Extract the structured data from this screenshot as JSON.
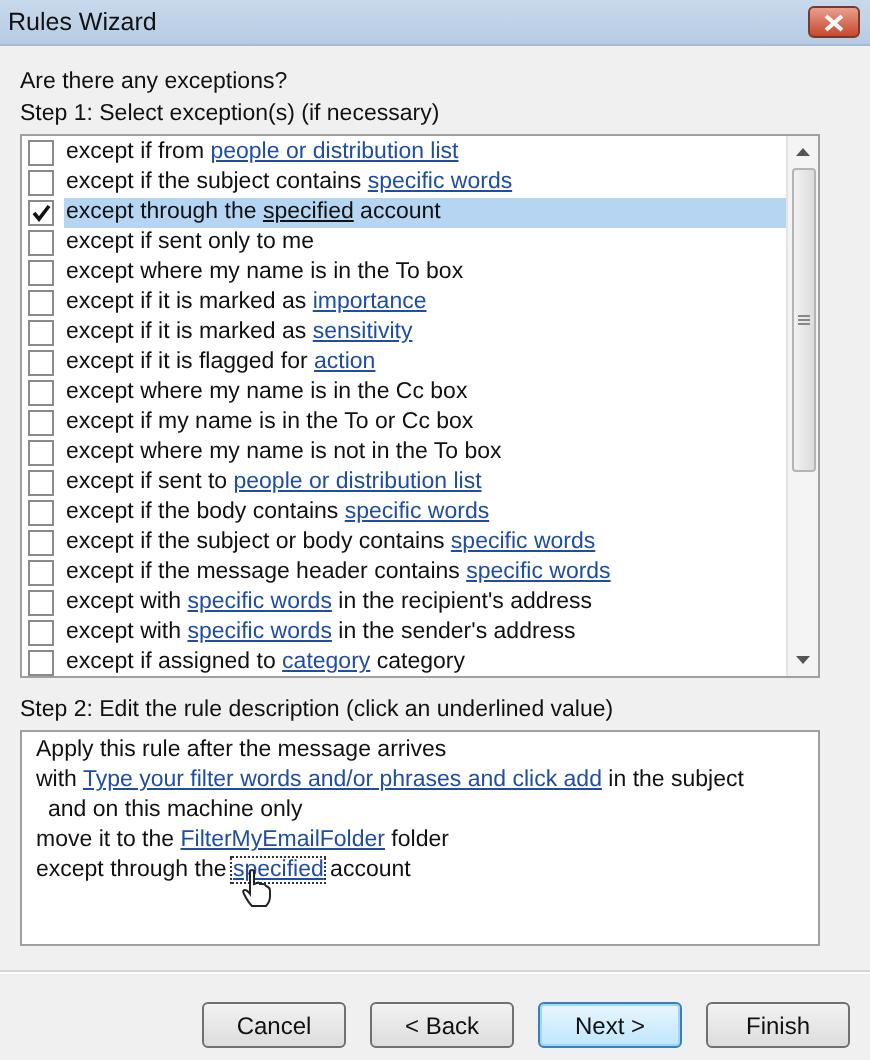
{
  "window": {
    "title": "Rules Wizard"
  },
  "question": "Are there any exceptions?",
  "step1_label": "Step 1: Select exception(s) (if necessary)",
  "exceptions": [
    {
      "checked": false,
      "selected": false,
      "parts": [
        {
          "text": "except if from ",
          "link": false
        },
        {
          "text": "people or distribution list",
          "link": true
        }
      ]
    },
    {
      "checked": false,
      "selected": false,
      "parts": [
        {
          "text": "except if the subject contains ",
          "link": false
        },
        {
          "text": "specific words",
          "link": true
        }
      ]
    },
    {
      "checked": true,
      "selected": true,
      "parts": [
        {
          "text": "except through the ",
          "link": false
        },
        {
          "text": "specified",
          "link": true
        },
        {
          "text": " account",
          "link": false
        }
      ]
    },
    {
      "checked": false,
      "selected": false,
      "parts": [
        {
          "text": "except if sent only to me",
          "link": false
        }
      ]
    },
    {
      "checked": false,
      "selected": false,
      "parts": [
        {
          "text": "except where my name is in the To box",
          "link": false
        }
      ]
    },
    {
      "checked": false,
      "selected": false,
      "parts": [
        {
          "text": "except if it is marked as ",
          "link": false
        },
        {
          "text": "importance",
          "link": true
        }
      ]
    },
    {
      "checked": false,
      "selected": false,
      "parts": [
        {
          "text": "except if it is marked as ",
          "link": false
        },
        {
          "text": "sensitivity",
          "link": true
        }
      ]
    },
    {
      "checked": false,
      "selected": false,
      "parts": [
        {
          "text": "except if it is flagged for ",
          "link": false
        },
        {
          "text": "action",
          "link": true
        }
      ]
    },
    {
      "checked": false,
      "selected": false,
      "parts": [
        {
          "text": "except where my name is in the Cc box",
          "link": false
        }
      ]
    },
    {
      "checked": false,
      "selected": false,
      "parts": [
        {
          "text": "except if my name is in the To or Cc box",
          "link": false
        }
      ]
    },
    {
      "checked": false,
      "selected": false,
      "parts": [
        {
          "text": "except where my name is not in the To box",
          "link": false
        }
      ]
    },
    {
      "checked": false,
      "selected": false,
      "parts": [
        {
          "text": "except if sent to ",
          "link": false
        },
        {
          "text": "people or distribution list",
          "link": true
        }
      ]
    },
    {
      "checked": false,
      "selected": false,
      "parts": [
        {
          "text": "except if the body contains ",
          "link": false
        },
        {
          "text": "specific words",
          "link": true
        }
      ]
    },
    {
      "checked": false,
      "selected": false,
      "parts": [
        {
          "text": "except if the subject or body contains ",
          "link": false
        },
        {
          "text": "specific words",
          "link": true
        }
      ]
    },
    {
      "checked": false,
      "selected": false,
      "parts": [
        {
          "text": "except if the message header contains ",
          "link": false
        },
        {
          "text": "specific words",
          "link": true
        }
      ]
    },
    {
      "checked": false,
      "selected": false,
      "parts": [
        {
          "text": "except with ",
          "link": false
        },
        {
          "text": "specific words",
          "link": true
        },
        {
          "text": " in the recipient's address",
          "link": false
        }
      ]
    },
    {
      "checked": false,
      "selected": false,
      "parts": [
        {
          "text": "except with ",
          "link": false
        },
        {
          "text": "specific words",
          "link": true
        },
        {
          "text": " in the sender's address",
          "link": false
        }
      ]
    },
    {
      "checked": false,
      "selected": false,
      "parts": [
        {
          "text": "except if assigned to ",
          "link": false
        },
        {
          "text": "category",
          "link": true
        },
        {
          "text": " category",
          "link": false
        }
      ]
    }
  ],
  "step2_label": "Step 2: Edit the rule description (click an underlined value)",
  "description": [
    {
      "indent": false,
      "parts": [
        {
          "text": "Apply this rule after the message arrives",
          "link": false
        }
      ]
    },
    {
      "indent": false,
      "parts": [
        {
          "text": "with ",
          "link": false
        },
        {
          "text": "Type your filter words and/or phrases and click add",
          "link": true
        },
        {
          "text": " in the subject",
          "link": false
        }
      ]
    },
    {
      "indent": true,
      "parts": [
        {
          "text": "and on this machine only",
          "link": false
        }
      ]
    },
    {
      "indent": false,
      "parts": [
        {
          "text": "move it to the ",
          "link": false
        },
        {
          "text": "FilterMyEmailFolder",
          "link": true
        },
        {
          "text": " folder",
          "link": false
        }
      ]
    },
    {
      "indent": false,
      "parts": [
        {
          "text": "except through the ",
          "link": false
        },
        {
          "text": "specified",
          "link": true,
          "focused": true
        },
        {
          "text": " account",
          "link": false
        }
      ]
    }
  ],
  "buttons": [
    {
      "label": "Cancel",
      "default": false
    },
    {
      "label": "< Back",
      "default": false
    },
    {
      "label": "Next >",
      "default": true
    },
    {
      "label": "Finish",
      "default": false
    }
  ]
}
